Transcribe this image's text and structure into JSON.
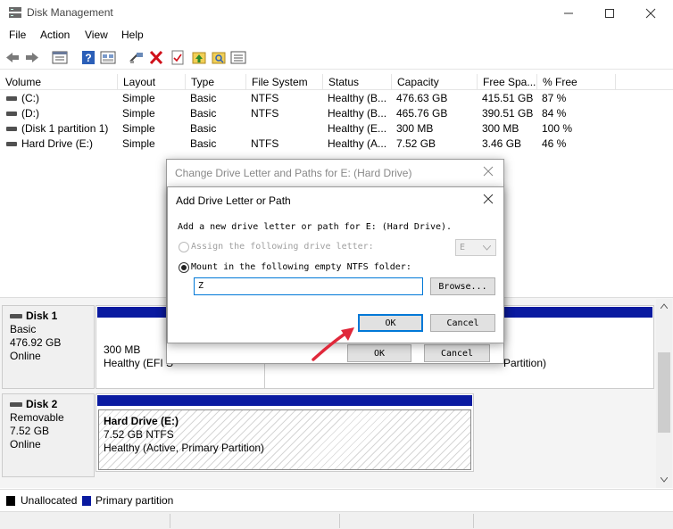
{
  "window": {
    "title": "Disk Management"
  },
  "menu": [
    "File",
    "Action",
    "View",
    "Help"
  ],
  "toolbar_icons": [
    "back-arrow-icon",
    "forward-arrow-icon",
    "properties-icon",
    "help-icon",
    "view-icon",
    "connect-icon",
    "delete-icon",
    "check-icon",
    "folder-up-icon",
    "search-folder-icon",
    "list-icon"
  ],
  "columns": [
    "Volume",
    "Layout",
    "Type",
    "File System",
    "Status",
    "Capacity",
    "Free Spa...",
    "% Free"
  ],
  "volumes": [
    {
      "volume": "(C:)",
      "layout": "Simple",
      "type": "Basic",
      "fs": "NTFS",
      "status": "Healthy (B...",
      "capacity": "476.63 GB",
      "free": "415.51 GB",
      "pct": "87 %"
    },
    {
      "volume": "(D:)",
      "layout": "Simple",
      "type": "Basic",
      "fs": "NTFS",
      "status": "Healthy (B...",
      "capacity": "465.76 GB",
      "free": "390.51 GB",
      "pct": "84 %"
    },
    {
      "volume": "(Disk 1 partition 1)",
      "layout": "Simple",
      "type": "Basic",
      "fs": "",
      "status": "Healthy (E...",
      "capacity": "300 MB",
      "free": "300 MB",
      "pct": "100 %"
    },
    {
      "volume": "Hard Drive (E:)",
      "layout": "Simple",
      "type": "Basic",
      "fs": "NTFS",
      "status": "Healthy (A...",
      "capacity": "7.52 GB",
      "free": "3.46 GB",
      "pct": "46 %"
    }
  ],
  "disk1": {
    "name": "Disk 1",
    "kind": "Basic",
    "size": "476.92 GB",
    "state": "Online",
    "part1_size": "300 MB",
    "part1_status": "Healthy (EFI S",
    "part2_status_tail": "Partition)"
  },
  "disk2": {
    "name": "Disk 2",
    "kind": "Removable",
    "size": "7.52 GB",
    "state": "Online",
    "part_name": "Hard Drive  (E:)",
    "part_size": "7.52 GB NTFS",
    "part_status": "Healthy (Active, Primary Partition)"
  },
  "legend": {
    "unallocated": "Unallocated",
    "primary": "Primary partition"
  },
  "colors": {
    "unallocated": "#000000",
    "primary": "#0a1aa0",
    "accent": "#0078d7",
    "arrow": "#e0283a"
  },
  "outer_dialog": {
    "title": "Change Drive Letter and Paths for E: (Hard Drive)",
    "ok": "OK",
    "cancel": "Cancel"
  },
  "inner_dialog": {
    "title": "Add Drive Letter or Path",
    "instruction": "Add a new drive letter or path for E: (Hard Drive).",
    "assign_label": "Assign the following drive letter:",
    "assign_value": "E",
    "mount_label": "Mount in the following empty NTFS folder:",
    "folder_value": "Z",
    "browse": "Browse...",
    "ok": "OK",
    "cancel": "Cancel"
  }
}
